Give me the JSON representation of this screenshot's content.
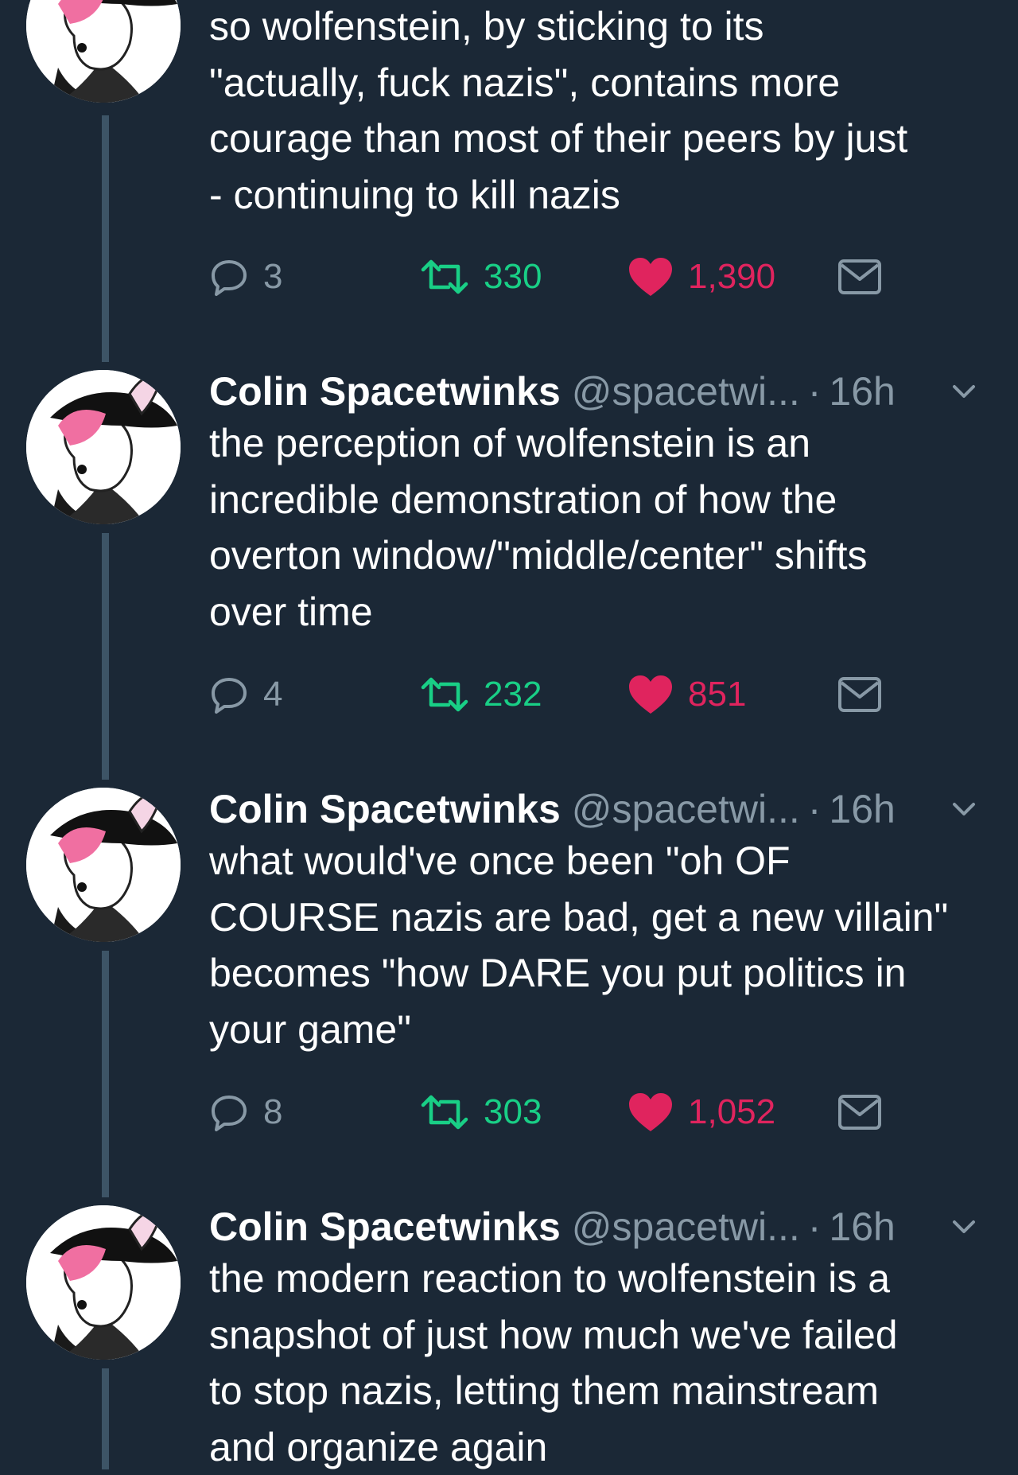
{
  "tweets": [
    {
      "name": "",
      "handle": "",
      "time": "",
      "text": "so wolfenstein, by sticking to its\n\"actually, fuck nazis\", contains more\ncourage than most of their peers by just\n- continuing to kill nazis",
      "replies": "3",
      "retweets": "330",
      "likes": "1,390"
    },
    {
      "name": "Colin Spacetwinks",
      "handle": "@spacetwi...",
      "sep": "·",
      "time": "16h",
      "text": "the perception of wolfenstein is an\nincredible demonstration of how the\noverton window/\"middle/center\" shifts\nover time",
      "replies": "4",
      "retweets": "232",
      "likes": "851"
    },
    {
      "name": "Colin Spacetwinks",
      "handle": "@spacetwi...",
      "sep": "·",
      "time": "16h",
      "text": "what would've once been \"oh OF\nCOURSE nazis are bad, get a new villain\"\nbecomes \"how DARE you put politics in\nyour game\"",
      "replies": "8",
      "retweets": "303",
      "likes": "1,052"
    },
    {
      "name": "Colin Spacetwinks",
      "handle": "@spacetwi...",
      "sep": "·",
      "time": "16h",
      "text": "the modern reaction to wolfenstein is a\nsnapshot of just how much we've failed\nto stop nazis, letting them mainstream\nand organize again"
    }
  ],
  "icons": {
    "reply": "reply-icon",
    "retweet": "retweet-icon",
    "like": "heart-icon",
    "dm": "envelope-icon",
    "caret": "chevron-down-icon"
  },
  "colors": {
    "background": "#1b2836",
    "muted": "#8899a6",
    "retweet": "#19cf86",
    "like": "#e0245e",
    "thread_line": "#3d5466"
  }
}
